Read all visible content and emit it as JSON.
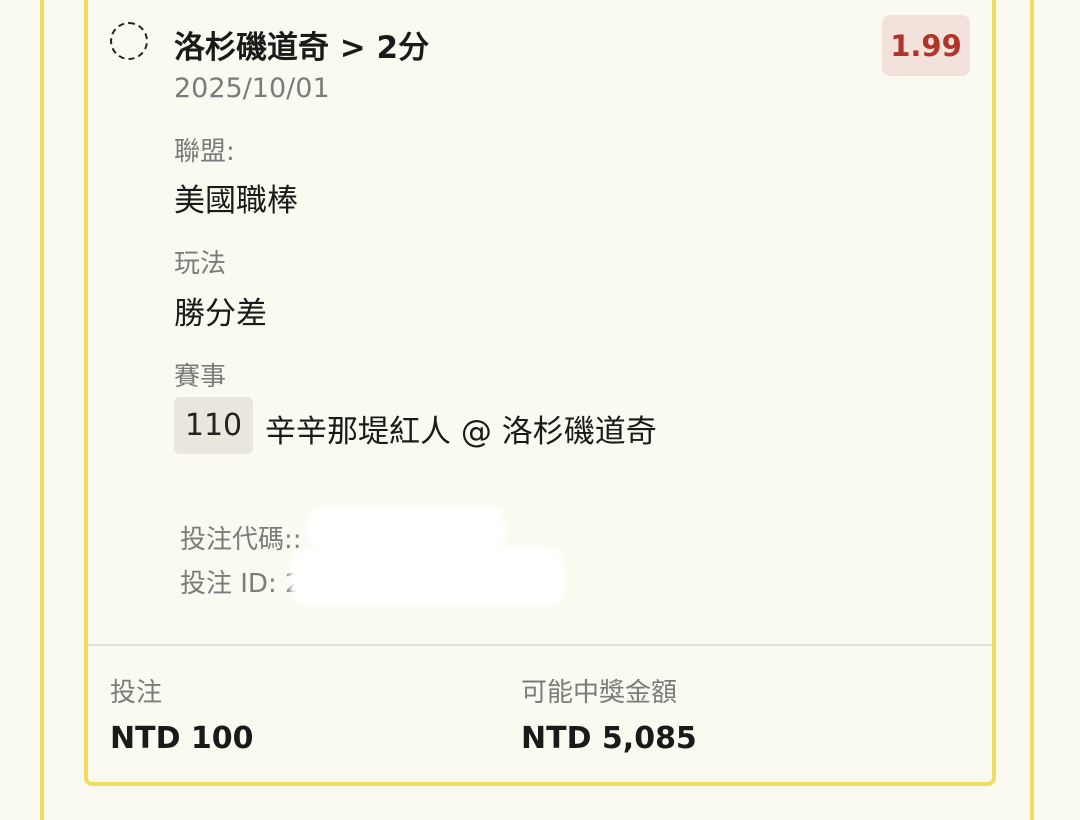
{
  "bet": {
    "selection": "洛杉磯道奇 > 2分",
    "date": "2025/10/01",
    "odds": "1.99",
    "league_label": "聯盟:",
    "league_value": "美國職棒",
    "market_label": "玩法",
    "market_value": "勝分差",
    "event_label": "賽事",
    "match_number": "110",
    "match_name": "辛辛那堤紅人 @ 洛杉磯道奇",
    "bet_code_label": "投注代碼::",
    "bet_id_label": "投注 ID: 2"
  },
  "summary": {
    "stake_label": "投注",
    "stake_value": "NTD 100",
    "payout_label": "可能中獎金額",
    "payout_value": "NTD 5,085"
  },
  "colors": {
    "accent_border": "#f1dc5f",
    "odds_text": "#b13429",
    "odds_bg": "#f3e1dc",
    "background": "#fbfaf1"
  }
}
